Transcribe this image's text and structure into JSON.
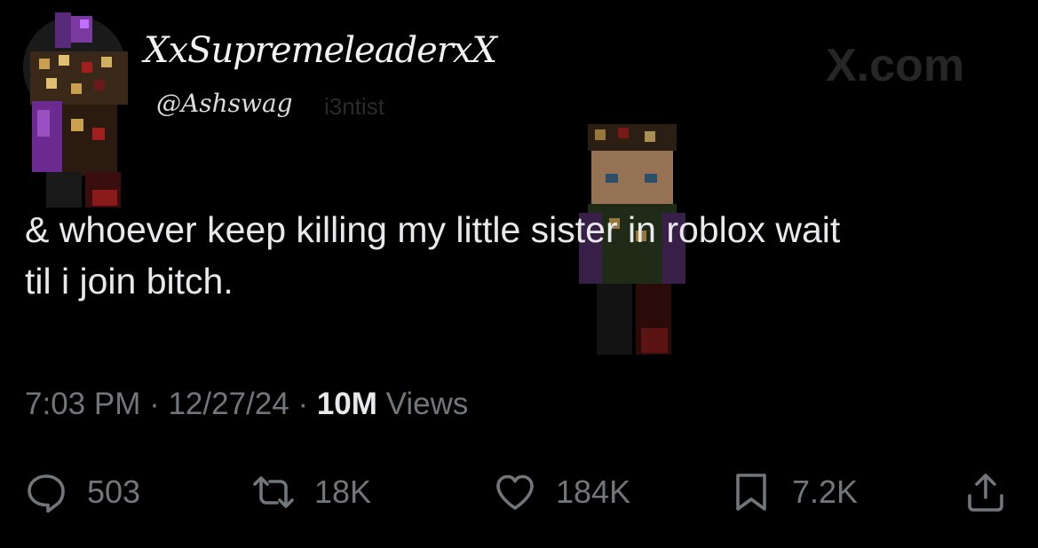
{
  "author": {
    "display_name": "XxSupremeleaderxX",
    "handle": "@Ashswag",
    "handle_ghost": "i3ntist",
    "avatar_icon": "minecraft-skin-avatar-icon"
  },
  "watermark": "X.com",
  "tweet": {
    "text": "& whoever keep killing my little sister in roblox wait\ntil i join bitch."
  },
  "meta": {
    "time": "7:03 PM",
    "separator1": " · ",
    "date": "12/27/24",
    "separator2": " · ",
    "views_count": "10M",
    "views_label": " Views"
  },
  "actions": {
    "reply": {
      "icon": "reply-icon",
      "count": "503"
    },
    "repost": {
      "icon": "repost-icon",
      "count": "18K"
    },
    "like": {
      "icon": "heart-icon",
      "count": "184K"
    },
    "bookmark": {
      "icon": "bookmark-icon",
      "count": "7.2K"
    },
    "share": {
      "icon": "share-icon"
    }
  },
  "colors": {
    "background": "#000000",
    "text": "#e7e9ea",
    "muted": "#71767b"
  }
}
